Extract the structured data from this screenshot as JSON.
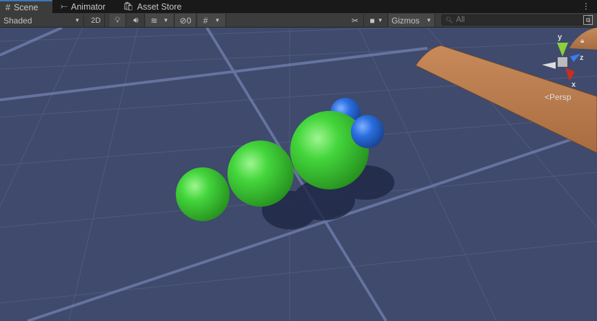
{
  "tabs": [
    {
      "label": "Scene",
      "icon": "grid-icon",
      "active": true
    },
    {
      "label": "Animator",
      "icon": "animator-icon"
    },
    {
      "label": "Asset Store",
      "icon": "bag-icon"
    }
  ],
  "toolbar": {
    "shading_mode": "Shaded",
    "toggle_2d": "2D",
    "hidden_count": "0",
    "gizmos": "Gizmos",
    "search_placeholder": "All"
  },
  "gizmo": {
    "y": "y",
    "z": "z",
    "x": "x",
    "projection": "Persp"
  },
  "colors": {
    "sky": "#3f4a6c",
    "sphere_green": "#3fd43a",
    "sphere_blue": "#2a6ee0",
    "plank": "#c88a5a"
  }
}
